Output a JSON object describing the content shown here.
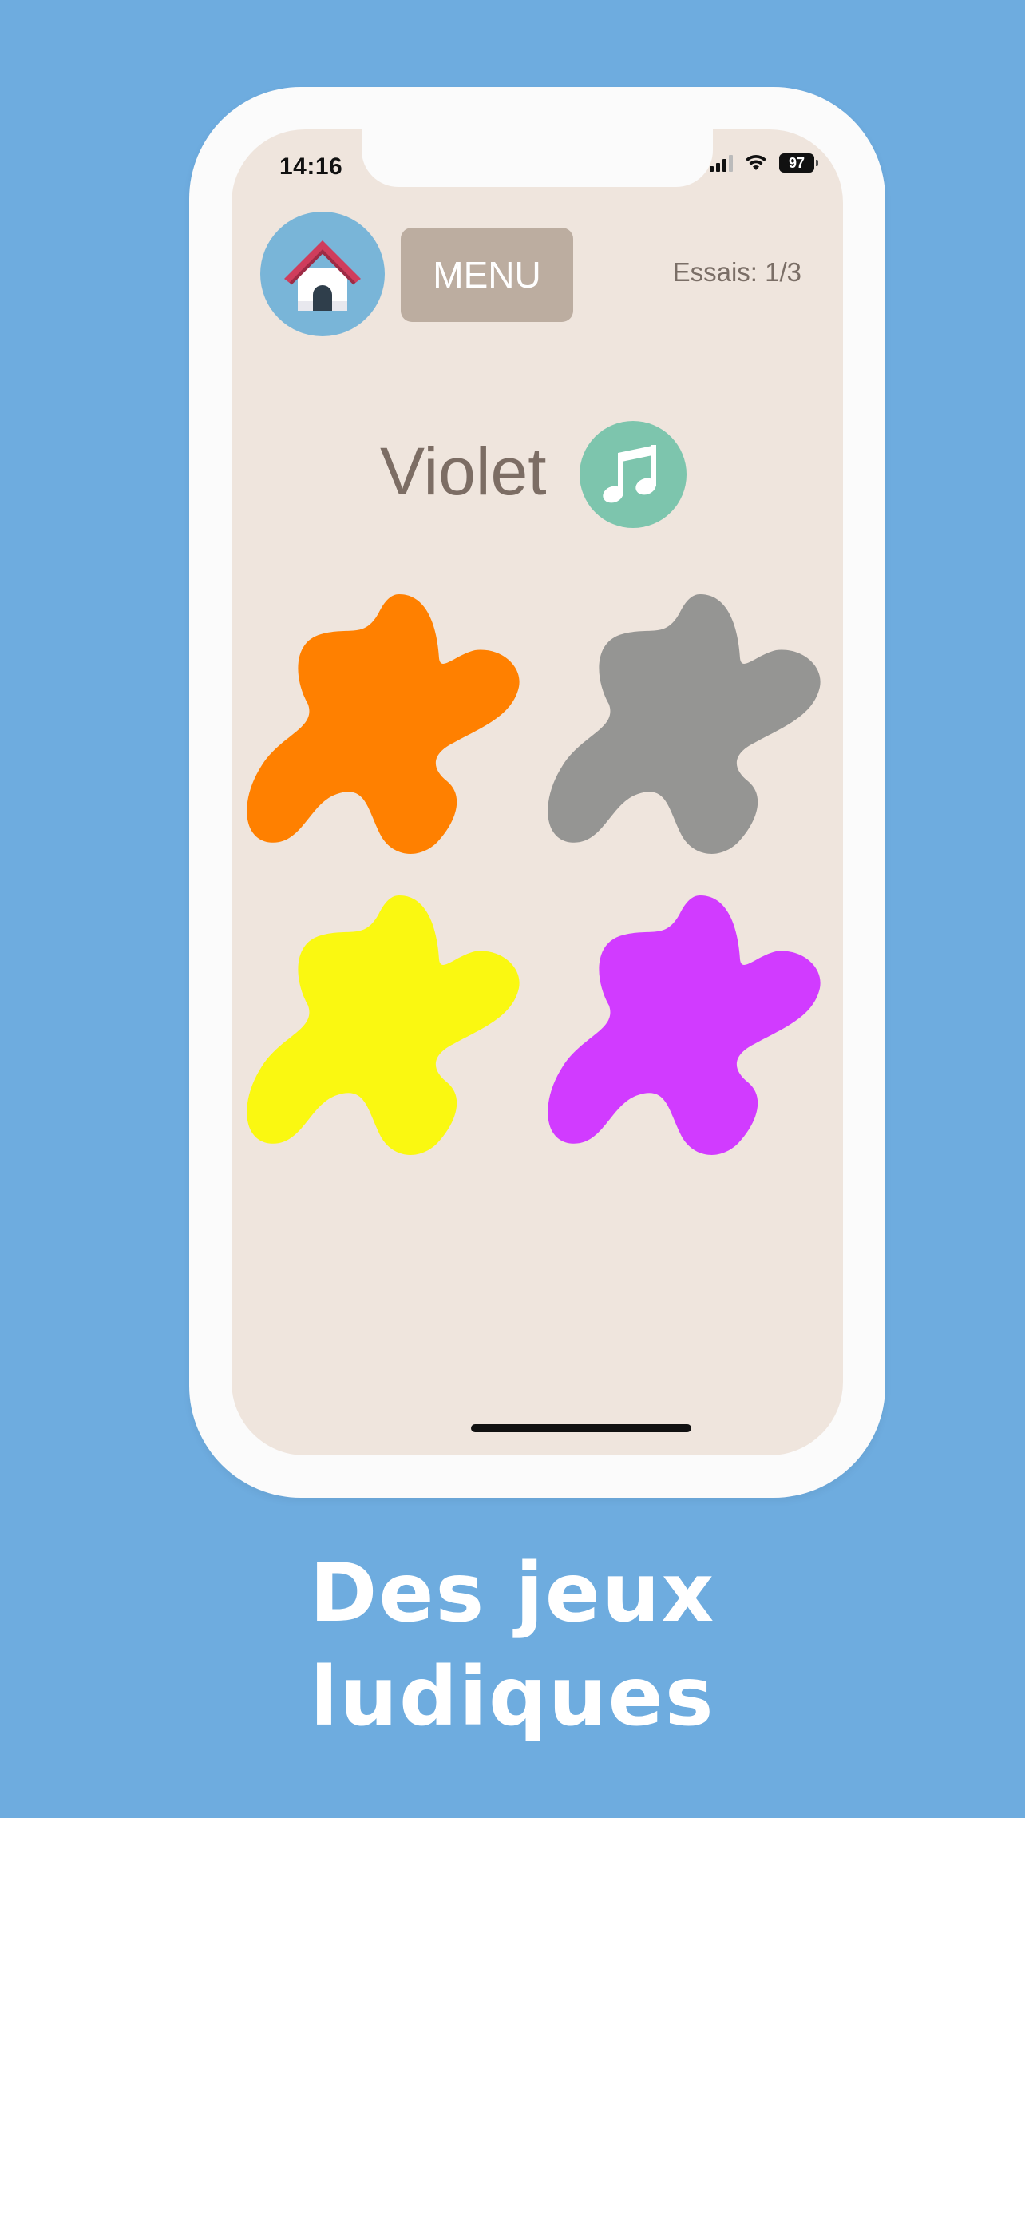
{
  "status_bar": {
    "time": "14:16",
    "battery": "97"
  },
  "header": {
    "menu_label": "MENU",
    "tries_label": "Essais: 1/3"
  },
  "prompt": {
    "color_word": "Violet"
  },
  "blobs": [
    {
      "name": "orange",
      "color": "#ff8000"
    },
    {
      "name": "gray",
      "color": "#959593"
    },
    {
      "name": "yellow",
      "color": "#faf811"
    },
    {
      "name": "violet",
      "color": "#d13bff"
    }
  ],
  "colors": {
    "background": "#6eacdf",
    "screen": "#efe5dd",
    "home_button": "#79b5d8",
    "menu_button": "#bcada0",
    "music_button": "#7dc5ad"
  },
  "icons": {
    "home": "house-icon",
    "music": "music-note-icon"
  },
  "caption": {
    "line1": "Des jeux",
    "line2": "ludiques"
  }
}
